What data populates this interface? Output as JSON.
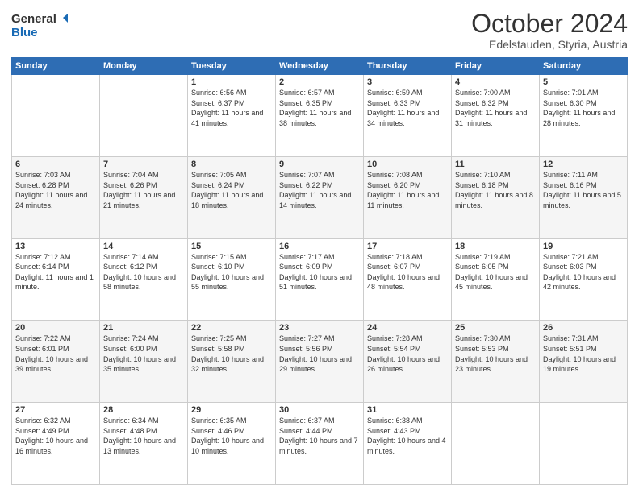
{
  "header": {
    "logo_line1": "General",
    "logo_line2": "Blue",
    "main_title": "October 2024",
    "subtitle": "Edelstauden, Styria, Austria"
  },
  "weekdays": [
    "Sunday",
    "Monday",
    "Tuesday",
    "Wednesday",
    "Thursday",
    "Friday",
    "Saturday"
  ],
  "weeks": [
    [
      {
        "day": "",
        "info": ""
      },
      {
        "day": "",
        "info": ""
      },
      {
        "day": "1",
        "info": "Sunrise: 6:56 AM\nSunset: 6:37 PM\nDaylight: 11 hours and 41 minutes."
      },
      {
        "day": "2",
        "info": "Sunrise: 6:57 AM\nSunset: 6:35 PM\nDaylight: 11 hours and 38 minutes."
      },
      {
        "day": "3",
        "info": "Sunrise: 6:59 AM\nSunset: 6:33 PM\nDaylight: 11 hours and 34 minutes."
      },
      {
        "day": "4",
        "info": "Sunrise: 7:00 AM\nSunset: 6:32 PM\nDaylight: 11 hours and 31 minutes."
      },
      {
        "day": "5",
        "info": "Sunrise: 7:01 AM\nSunset: 6:30 PM\nDaylight: 11 hours and 28 minutes."
      }
    ],
    [
      {
        "day": "6",
        "info": "Sunrise: 7:03 AM\nSunset: 6:28 PM\nDaylight: 11 hours and 24 minutes."
      },
      {
        "day": "7",
        "info": "Sunrise: 7:04 AM\nSunset: 6:26 PM\nDaylight: 11 hours and 21 minutes."
      },
      {
        "day": "8",
        "info": "Sunrise: 7:05 AM\nSunset: 6:24 PM\nDaylight: 11 hours and 18 minutes."
      },
      {
        "day": "9",
        "info": "Sunrise: 7:07 AM\nSunset: 6:22 PM\nDaylight: 11 hours and 14 minutes."
      },
      {
        "day": "10",
        "info": "Sunrise: 7:08 AM\nSunset: 6:20 PM\nDaylight: 11 hours and 11 minutes."
      },
      {
        "day": "11",
        "info": "Sunrise: 7:10 AM\nSunset: 6:18 PM\nDaylight: 11 hours and 8 minutes."
      },
      {
        "day": "12",
        "info": "Sunrise: 7:11 AM\nSunset: 6:16 PM\nDaylight: 11 hours and 5 minutes."
      }
    ],
    [
      {
        "day": "13",
        "info": "Sunrise: 7:12 AM\nSunset: 6:14 PM\nDaylight: 11 hours and 1 minute."
      },
      {
        "day": "14",
        "info": "Sunrise: 7:14 AM\nSunset: 6:12 PM\nDaylight: 10 hours and 58 minutes."
      },
      {
        "day": "15",
        "info": "Sunrise: 7:15 AM\nSunset: 6:10 PM\nDaylight: 10 hours and 55 minutes."
      },
      {
        "day": "16",
        "info": "Sunrise: 7:17 AM\nSunset: 6:09 PM\nDaylight: 10 hours and 51 minutes."
      },
      {
        "day": "17",
        "info": "Sunrise: 7:18 AM\nSunset: 6:07 PM\nDaylight: 10 hours and 48 minutes."
      },
      {
        "day": "18",
        "info": "Sunrise: 7:19 AM\nSunset: 6:05 PM\nDaylight: 10 hours and 45 minutes."
      },
      {
        "day": "19",
        "info": "Sunrise: 7:21 AM\nSunset: 6:03 PM\nDaylight: 10 hours and 42 minutes."
      }
    ],
    [
      {
        "day": "20",
        "info": "Sunrise: 7:22 AM\nSunset: 6:01 PM\nDaylight: 10 hours and 39 minutes."
      },
      {
        "day": "21",
        "info": "Sunrise: 7:24 AM\nSunset: 6:00 PM\nDaylight: 10 hours and 35 minutes."
      },
      {
        "day": "22",
        "info": "Sunrise: 7:25 AM\nSunset: 5:58 PM\nDaylight: 10 hours and 32 minutes."
      },
      {
        "day": "23",
        "info": "Sunrise: 7:27 AM\nSunset: 5:56 PM\nDaylight: 10 hours and 29 minutes."
      },
      {
        "day": "24",
        "info": "Sunrise: 7:28 AM\nSunset: 5:54 PM\nDaylight: 10 hours and 26 minutes."
      },
      {
        "day": "25",
        "info": "Sunrise: 7:30 AM\nSunset: 5:53 PM\nDaylight: 10 hours and 23 minutes."
      },
      {
        "day": "26",
        "info": "Sunrise: 7:31 AM\nSunset: 5:51 PM\nDaylight: 10 hours and 19 minutes."
      }
    ],
    [
      {
        "day": "27",
        "info": "Sunrise: 6:32 AM\nSunset: 4:49 PM\nDaylight: 10 hours and 16 minutes."
      },
      {
        "day": "28",
        "info": "Sunrise: 6:34 AM\nSunset: 4:48 PM\nDaylight: 10 hours and 13 minutes."
      },
      {
        "day": "29",
        "info": "Sunrise: 6:35 AM\nSunset: 4:46 PM\nDaylight: 10 hours and 10 minutes."
      },
      {
        "day": "30",
        "info": "Sunrise: 6:37 AM\nSunset: 4:44 PM\nDaylight: 10 hours and 7 minutes."
      },
      {
        "day": "31",
        "info": "Sunrise: 6:38 AM\nSunset: 4:43 PM\nDaylight: 10 hours and 4 minutes."
      },
      {
        "day": "",
        "info": ""
      },
      {
        "day": "",
        "info": ""
      }
    ]
  ]
}
